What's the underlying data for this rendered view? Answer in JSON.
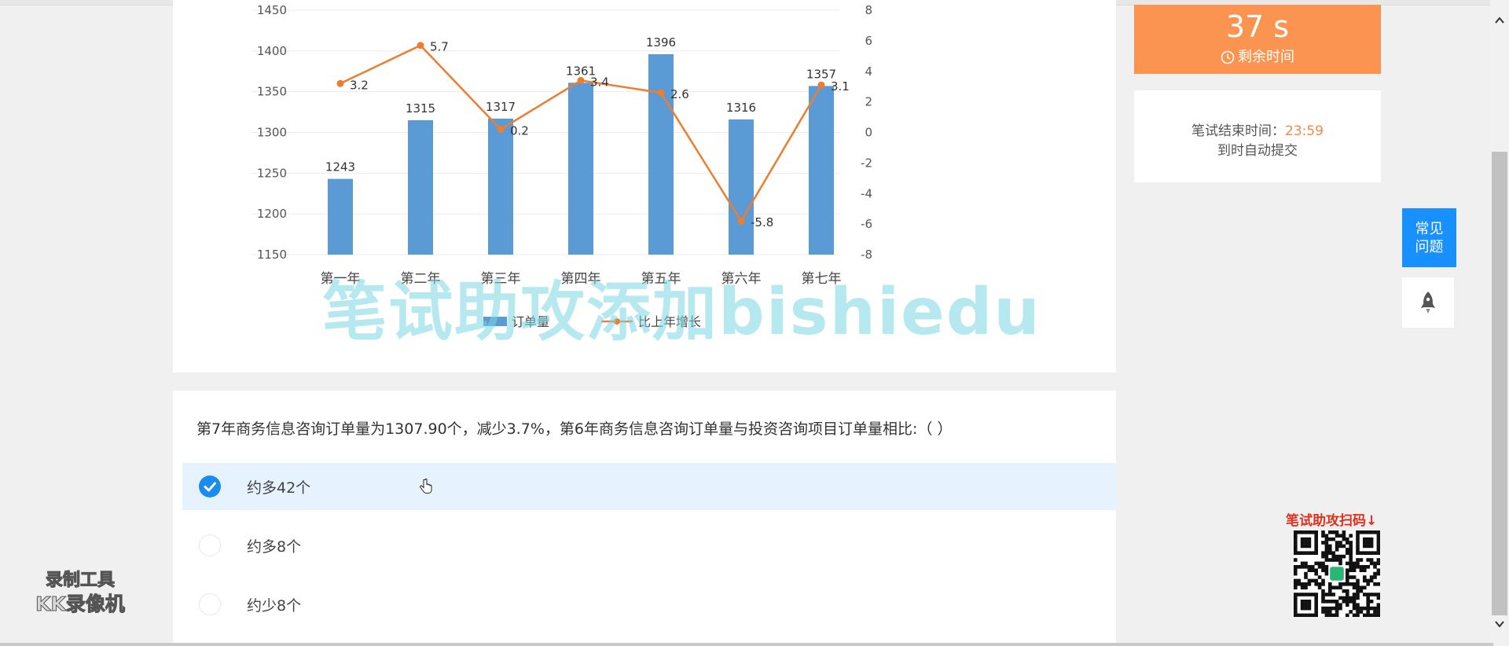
{
  "chart_data": {
    "type": "bar",
    "categories": [
      "第一年",
      "第二年",
      "第三年",
      "第四年",
      "第五年",
      "第六年",
      "第七年"
    ],
    "series": [
      {
        "name": "订单量",
        "type": "bar",
        "axis": "left",
        "values": [
          1243,
          1315,
          1317,
          1361,
          1396,
          1316,
          1357
        ]
      },
      {
        "name": "比上年增长",
        "type": "line",
        "axis": "right",
        "values": [
          3.2,
          5.7,
          0.2,
          3.4,
          2.6,
          -5.8,
          3.1
        ]
      }
    ],
    "left_axis": {
      "ylim": [
        1150,
        1450
      ],
      "ticks": [
        1150,
        1200,
        1250,
        1300,
        1350,
        1400,
        1450
      ]
    },
    "right_axis": {
      "ylim": [
        -8,
        8
      ],
      "ticks": [
        -8,
        -6,
        -4,
        -2,
        0,
        2,
        4,
        6,
        8
      ]
    },
    "legend_position": "bottom",
    "bar_color": "#5b9bd5",
    "line_color": "#ed7d31"
  },
  "question": {
    "text": "第7年商务信息咨询订单量为1307.90个，减少3.7%，第6年商务信息咨询订单量与投资咨询项目订单量相比:（   ）",
    "options": [
      {
        "label": "约多42个",
        "selected": true
      },
      {
        "label": "约多8个",
        "selected": false
      },
      {
        "label": "约少8个",
        "selected": false
      }
    ]
  },
  "timer": {
    "value": "37 s",
    "label": "剩余时间",
    "icon": "clock-icon"
  },
  "end_time": {
    "prefix": "笔试结束时间：",
    "time": "23:59",
    "note": "到时自动提交"
  },
  "faq_button": {
    "line1": "常见",
    "line2": "问题"
  },
  "rocket_button": {
    "icon": "rocket-icon"
  },
  "promo": {
    "text": "笔试助攻扫码↓"
  },
  "recorder": {
    "line1": "录制工具",
    "line2": "KK录像机"
  },
  "watermark": "笔试助攻添加bishiedu",
  "colors": {
    "accent": "#1890ff",
    "timer_bg": "#fb9450",
    "selected_bg": "#e6f2fd"
  }
}
